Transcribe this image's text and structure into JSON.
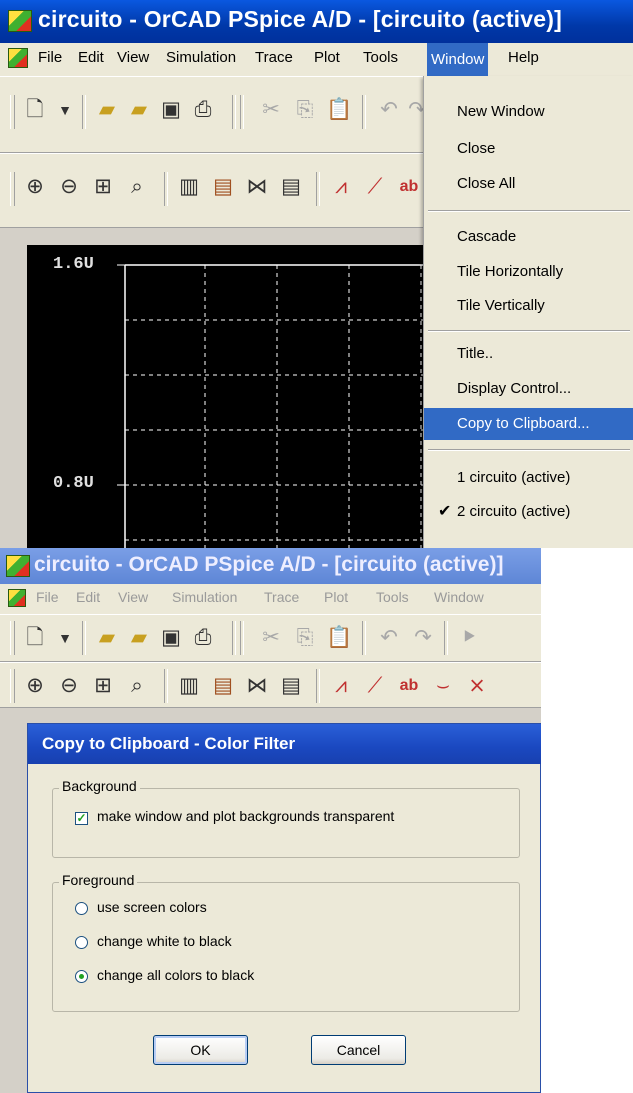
{
  "top_window": {
    "title": "circuito - OrCAD PSpice A/D  - [circuito (active)]",
    "menus": [
      "File",
      "Edit",
      "View",
      "Simulation",
      "Trace",
      "Plot",
      "Tools",
      "Window",
      "Help"
    ],
    "open_menu": "Window",
    "plot": {
      "y_labels": [
        "1.6U",
        "0.8U"
      ],
      "background": "#000000",
      "grid_color": "#ffffff"
    },
    "window_menu": {
      "items": [
        {
          "label": "New Window"
        },
        {
          "label": "Close"
        },
        {
          "label": "Close All"
        },
        {
          "label": "Cascade"
        },
        {
          "label": "Tile Horizontally"
        },
        {
          "label": "Tile Vertically"
        },
        {
          "label": "Title.."
        },
        {
          "label": "Display Control..."
        },
        {
          "label": "Copy to Clipboard...",
          "highlighted": true
        },
        {
          "label": "1 circuito (active)"
        },
        {
          "label": "2 circuito (active)",
          "checked": true
        }
      ]
    }
  },
  "bottom_window": {
    "title": "circuito - OrCAD PSpice A/D  - [circuito (active)]",
    "menus": [
      "File",
      "Edit",
      "View",
      "Simulation",
      "Trace",
      "Plot",
      "Tools",
      "Window"
    ]
  },
  "dialog": {
    "title": "Copy to Clipboard - Color Filter",
    "background_group": {
      "label": "Background",
      "checkbox_label": "make window and plot backgrounds transparent",
      "checked": true
    },
    "foreground_group": {
      "label": "Foreground",
      "options": [
        {
          "label": "use screen colors",
          "selected": false
        },
        {
          "label": "change white to black",
          "selected": false
        },
        {
          "label": "change all colors to black",
          "selected": true
        }
      ]
    },
    "ok_label": "OK",
    "cancel_label": "Cancel"
  },
  "colors": {
    "menu_highlight": "#316ac5",
    "title_active": "#0a58e0",
    "title_inactive": "#7a9ee6",
    "dialog_title": "#1a48c0"
  },
  "icons": {
    "toolbar1": [
      "new-document-icon",
      "dropdown-arrow-icon",
      "open-folder-icon",
      "open-folder-alt-icon",
      "save-icon",
      "print-icon",
      "cut-icon",
      "copy-icon",
      "paste-icon",
      "undo-icon"
    ],
    "toolbar2": [
      "zoom-in-icon",
      "zoom-out-icon",
      "zoom-area-icon",
      "zoom-fit-icon",
      "axis-settings-icon",
      "add-trace-icon",
      "toggle-fft-icon",
      "plot-window-icon",
      "cursor-peak-icon",
      "trace-mark-icon",
      "label-icon"
    ]
  }
}
